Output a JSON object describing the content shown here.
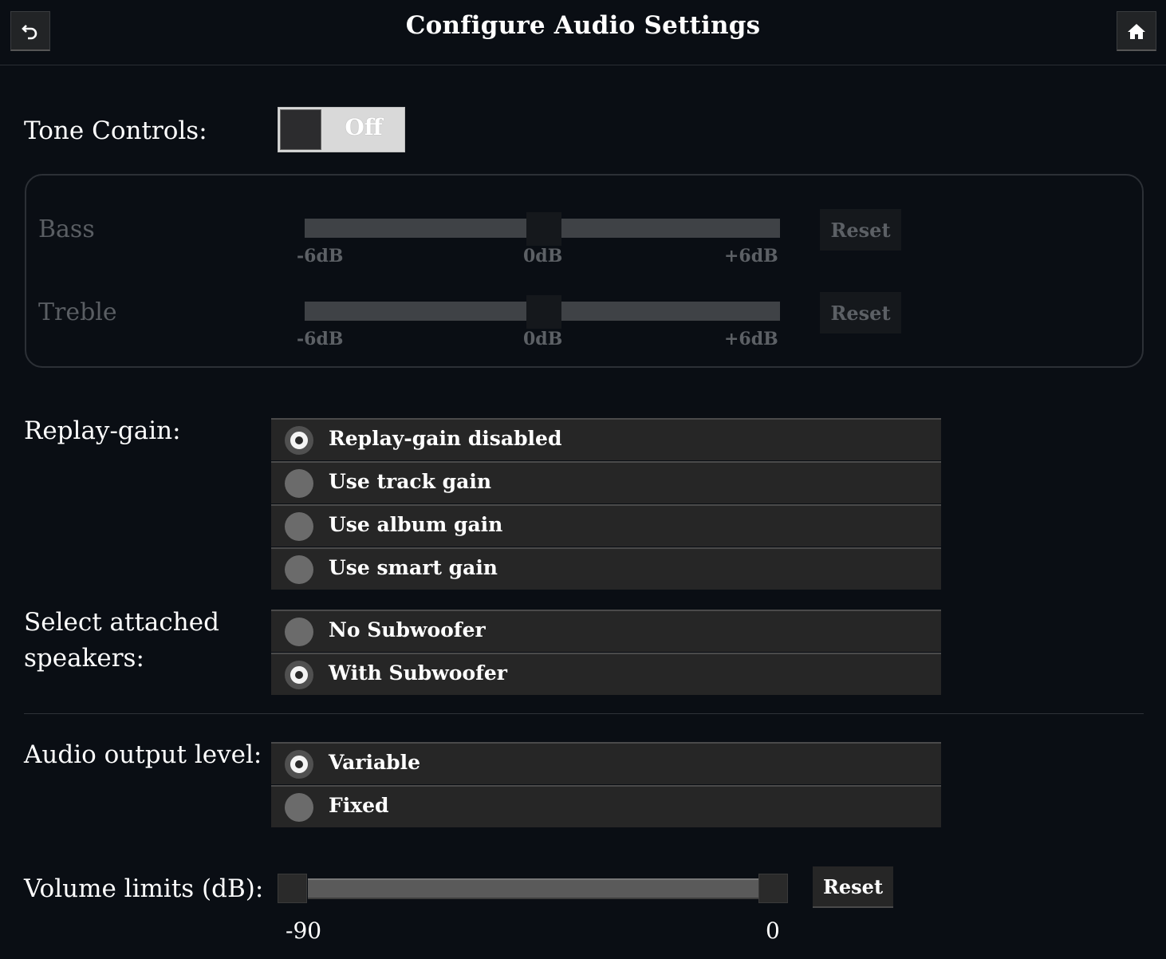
{
  "header": {
    "title": "Configure Audio Settings",
    "back_icon": "back-arrow-icon",
    "home_icon": "home-icon"
  },
  "tone_controls": {
    "label": "Tone Controls:",
    "toggle_state": "Off",
    "bass": {
      "label": "Bass",
      "min_label": "-6dB",
      "mid_label": "0dB",
      "max_label": "+6dB",
      "value_db": 0,
      "reset_label": "Reset"
    },
    "treble": {
      "label": "Treble",
      "min_label": "-6dB",
      "mid_label": "0dB",
      "max_label": "+6dB",
      "value_db": 0,
      "reset_label": "Reset"
    }
  },
  "replay_gain": {
    "label": "Replay-gain:",
    "options": [
      {
        "label": "Replay-gain disabled",
        "selected": true
      },
      {
        "label": "Use track gain",
        "selected": false
      },
      {
        "label": "Use album gain",
        "selected": false
      },
      {
        "label": "Use smart gain",
        "selected": false
      }
    ]
  },
  "speakers": {
    "label_line1": "Select attached",
    "label_line2": "speakers:",
    "options": [
      {
        "label": "No Subwoofer",
        "selected": false
      },
      {
        "label": "With Subwoofer",
        "selected": true
      }
    ]
  },
  "output_level": {
    "label": "Audio output level:",
    "options": [
      {
        "label": "Variable",
        "selected": true
      },
      {
        "label": "Fixed",
        "selected": false
      }
    ]
  },
  "volume_limits": {
    "label": "Volume limits (dB):",
    "min_label": "-90",
    "max_label": "0",
    "low_value": -90,
    "high_value": 0,
    "reset_label": "Reset"
  }
}
